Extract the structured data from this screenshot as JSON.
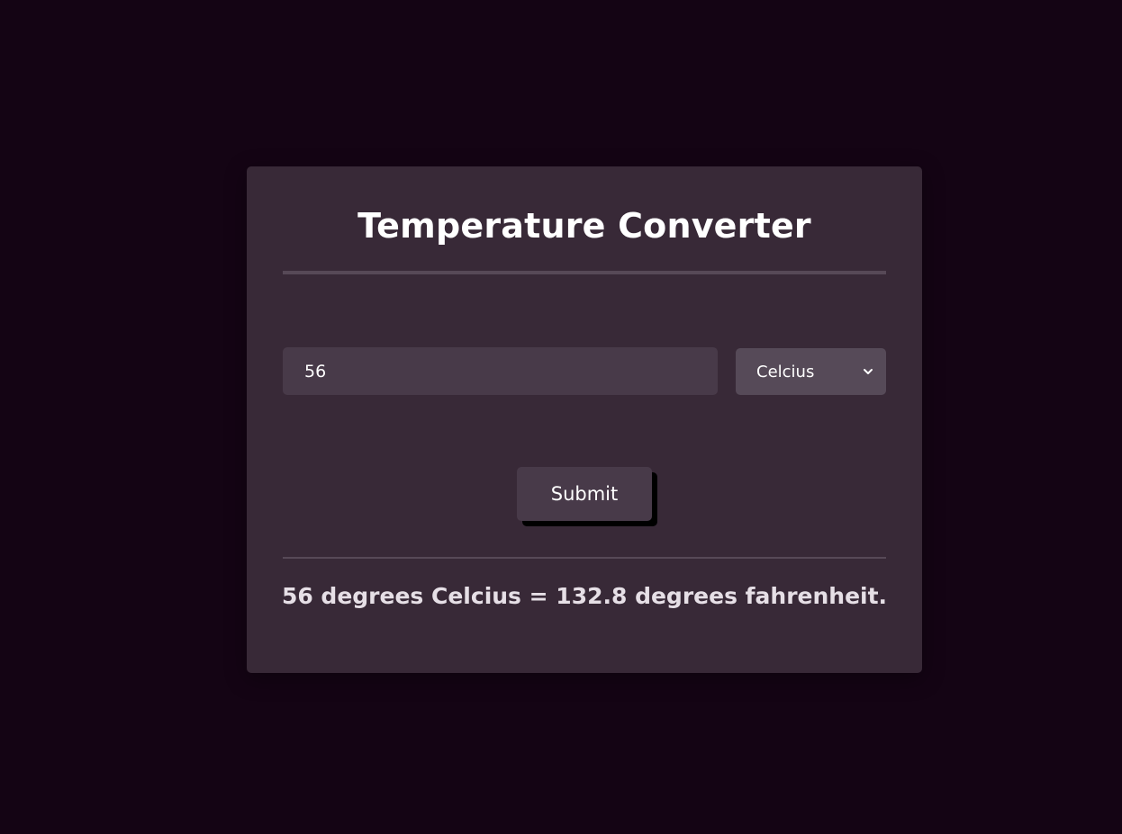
{
  "converter": {
    "title": "Temperature Converter",
    "input_value": "56",
    "unit_selected": "Celcius",
    "submit_label": "Submit",
    "result_text": "56 degrees Celcius = 132.8 degrees fahrenheit."
  },
  "icons": {
    "select_arrow": "chevron-down-icon"
  },
  "colors": {
    "page_background": "#140414",
    "card_background": "#382937",
    "input_background": "#483a49",
    "select_background": "#564a58",
    "divider": "#574957",
    "text": "#ffffff"
  }
}
